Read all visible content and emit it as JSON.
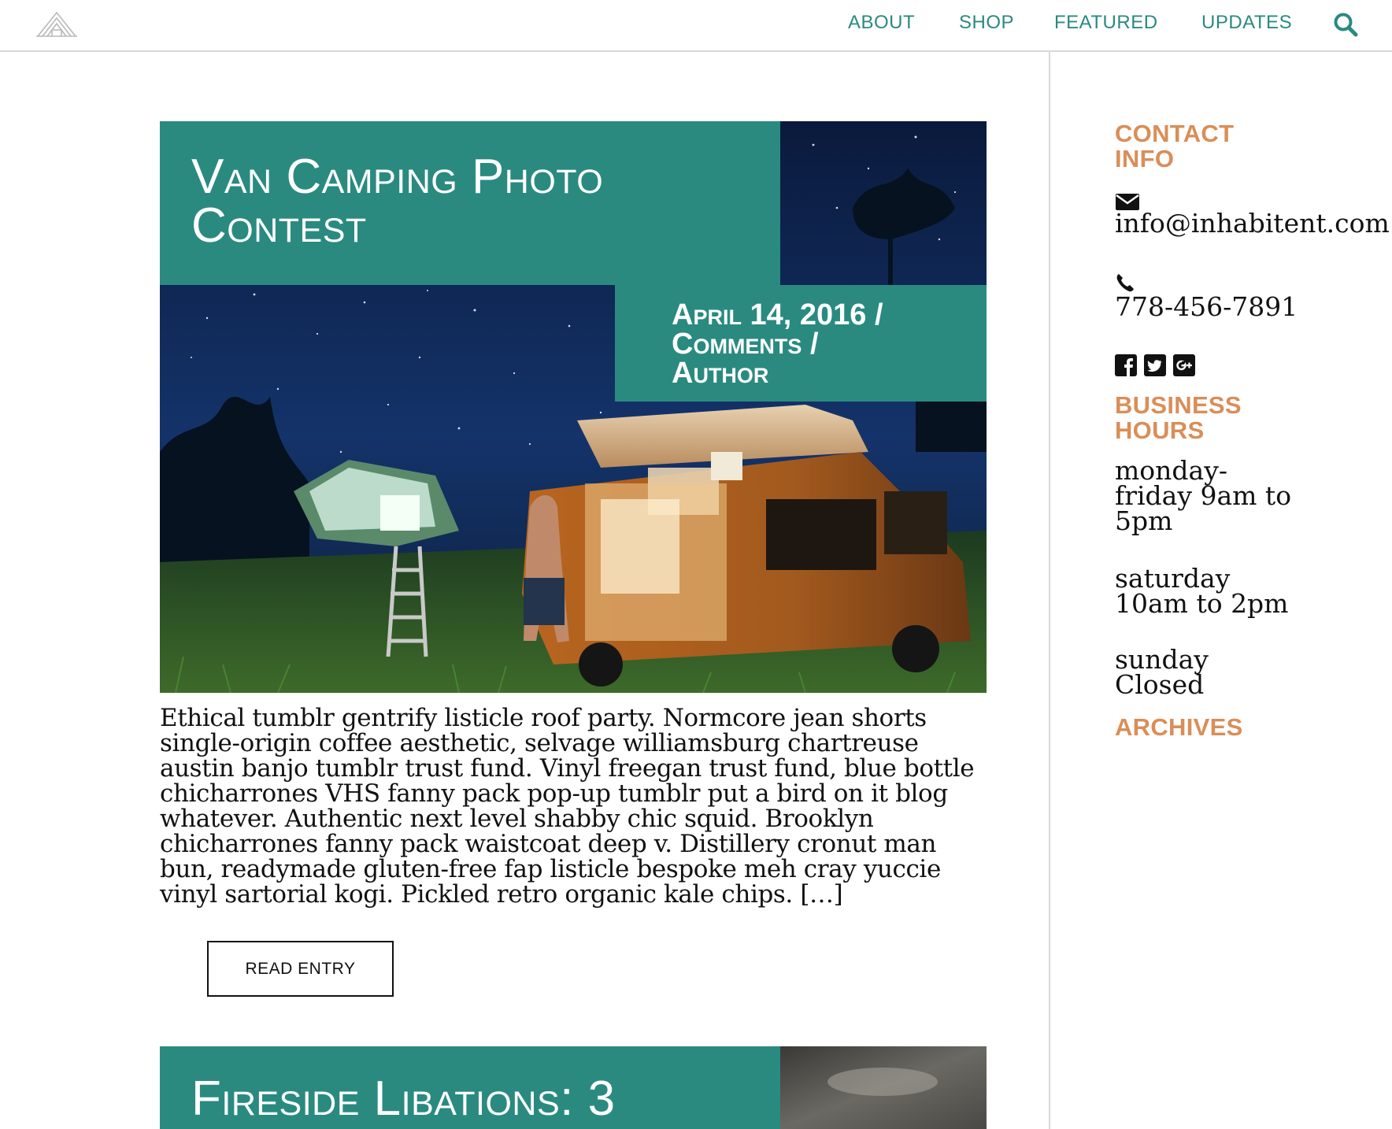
{
  "header": {
    "logo_icon": "tent-logo-icon",
    "nav": [
      {
        "label": "ABOUT"
      },
      {
        "label": "SHOP"
      },
      {
        "label": "FEATURED"
      },
      {
        "label": "UPDATES"
      }
    ],
    "search_icon": "search-icon"
  },
  "colors": {
    "accent_teal": "#2a8a80",
    "accent_orange": "#d98e58",
    "text": "#111111",
    "divider": "#d9d9d9"
  },
  "posts": [
    {
      "title": "Van Camping Photo Contest",
      "meta_date": "April 14, 2016 /",
      "meta_comments": "Comments /",
      "meta_author": "Author",
      "excerpt": "Ethical tumblr gentrify listicle roof party. Normcore jean shorts single-origin coffee aesthetic, selvage williamsburg chartreuse austin banjo tumblr trust fund. Vinyl freegan trust fund, blue bottle chicharrones VHS fanny pack pop-up tumblr put a bird on it blog whatever. Authentic next level shabby chic squid. Brooklyn chicharrones fanny pack waistcoat deep v. Distillery cronut man bun, readymade gluten-free fap listicle bespoke meh cray yuccie vinyl sartorial kogi. Pickled retro organic kale chips. […]",
      "read_label": "READ ENTRY"
    },
    {
      "title": "Fireside Libations: 3"
    }
  ],
  "sidebar": {
    "contact_heading_line1": "CONTACT",
    "contact_heading_line2": "INFO",
    "email_icon": "envelope-icon",
    "email": "info@inhabitent.com",
    "phone_icon": "phone-icon",
    "phone": "778-456-7891",
    "social_icons": [
      "facebook-icon",
      "twitter-icon",
      "google-plus-icon"
    ],
    "hours_heading_line1": "BUSINESS",
    "hours_heading_line2": "HOURS",
    "hours_weekday_l1": "monday-",
    "hours_weekday_l2": "friday 9am to",
    "hours_weekday_l3": "5pm",
    "hours_sat_l1": "saturday",
    "hours_sat_l2": "10am to 2pm",
    "hours_sun_l1": "sunday",
    "hours_sun_l2": "Closed",
    "archives_heading": "ARCHIVES"
  }
}
